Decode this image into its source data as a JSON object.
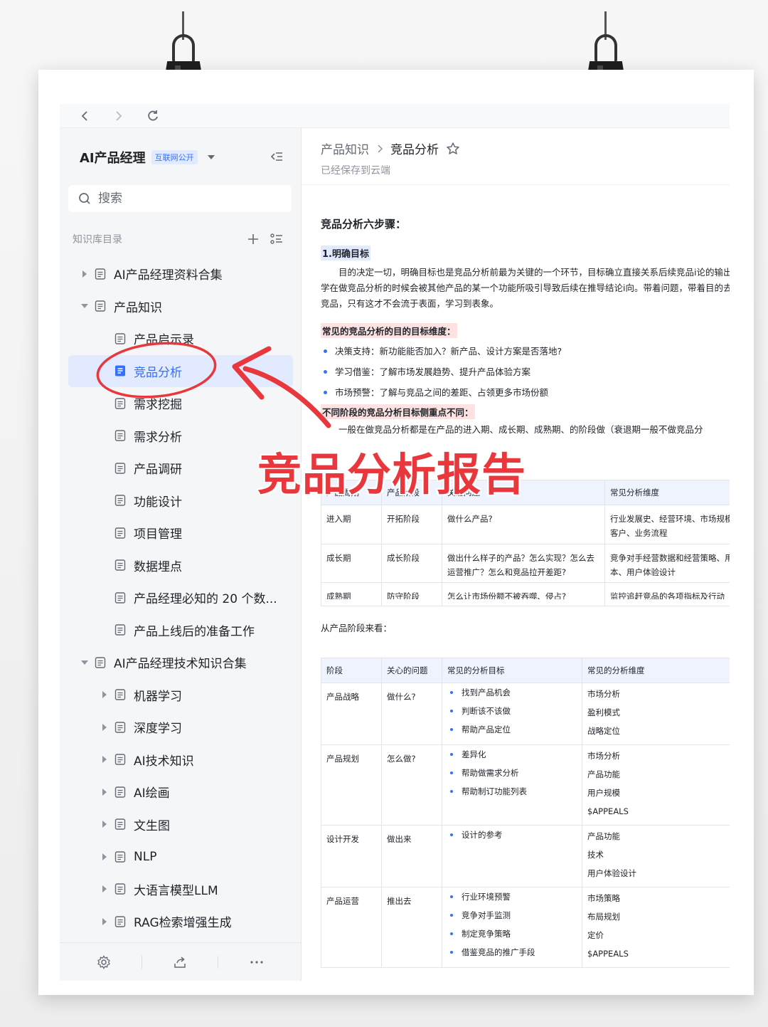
{
  "sidebar": {
    "kb_title": "AI产品经理",
    "kb_badge": "互联网公开",
    "search_placeholder": "搜索",
    "dir_label": "知识库目录",
    "items": [
      {
        "label": "AI产品经理资料合集",
        "level": 0,
        "toggle": "collapsed"
      },
      {
        "label": "产品知识",
        "level": 0,
        "toggle": "expanded"
      },
      {
        "label": "产品启示录",
        "level": 1,
        "toggle": "none"
      },
      {
        "label": "竞品分析",
        "level": 1,
        "toggle": "none",
        "active": true
      },
      {
        "label": "需求挖掘",
        "level": 1,
        "toggle": "none"
      },
      {
        "label": "需求分析",
        "level": 1,
        "toggle": "none"
      },
      {
        "label": "产品调研",
        "level": 1,
        "toggle": "none"
      },
      {
        "label": "功能设计",
        "level": 1,
        "toggle": "none"
      },
      {
        "label": "项目管理",
        "level": 1,
        "toggle": "none"
      },
      {
        "label": "数据埋点",
        "level": 1,
        "toggle": "none"
      },
      {
        "label": "产品经理必知的 20 个数...",
        "level": 1,
        "toggle": "none"
      },
      {
        "label": "产品上线后的准备工作",
        "level": 1,
        "toggle": "none"
      },
      {
        "label": "AI产品经理技术知识合集",
        "level": 0,
        "toggle": "expanded"
      },
      {
        "label": "机器学习",
        "level": 1,
        "toggle": "collapsed"
      },
      {
        "label": "深度学习",
        "level": 1,
        "toggle": "collapsed"
      },
      {
        "label": "AI技术知识",
        "level": 1,
        "toggle": "collapsed"
      },
      {
        "label": "AI绘画",
        "level": 1,
        "toggle": "collapsed"
      },
      {
        "label": "文生图",
        "level": 1,
        "toggle": "collapsed"
      },
      {
        "label": "NLP",
        "level": 1,
        "toggle": "collapsed"
      },
      {
        "label": "大语言模型LLM",
        "level": 1,
        "toggle": "collapsed"
      },
      {
        "label": "RAG检索增强生成",
        "level": 1,
        "toggle": "collapsed"
      }
    ]
  },
  "header": {
    "breadcrumb_parent": "产品知识",
    "breadcrumb_current": "竞品分析",
    "saved_status": "已经保存到云端"
  },
  "doc": {
    "title": "竞品分析六步骤：",
    "step1": "1.明确目标",
    "para1": "目的决定一切，明确目标也是竞品分析前最为关键的一个环节，目标确立直接关系后续竞品i论的输出。很多同学在做竞品分析的时候会被其他产品的某一个功能所吸引导致后续在推导结论i向。带着问题，带着目的去分析体验竞品，只有这才不会流于表面，学习到表象。",
    "hl1": "常见的竞品分析的目的目标维度：",
    "bullets1": [
      "决策支持：新功能能否加入？新产品、设计方案是否落地?",
      "学习借鉴：了解市场发展趋势、提升产品体验方案",
      "市场预警：了解与竞品之间的差距、占领更多市场份额"
    ],
    "hl2": "不同阶段的竞品分析目标侧重点不同：",
    "para2": "一般在做竞品分析都是在产品的进入期、成长期、成熟期、的阶段做（衰退期一般不做竞品分",
    "table1": {
      "headers": [
        "产品周期",
        "产品阶段",
        "关注问题",
        "常见分析维度"
      ],
      "rows": [
        [
          "进入期",
          "开拓阶段",
          "做什么产品?",
          "行业发展史、经营环境、市场规模、产品发展史、目标客户、业务流程"
        ],
        [
          "成长期",
          "成长阶段",
          "做出什么样子的产品？怎么实现？怎么去运营推广？怎么和竞品拉开差距?",
          "竞争对手经营数据和经营策略、用户规模、研发技术成本、用户体验设计"
        ],
        [
          "成熟期",
          "防守阶段",
          "怎么让市场份额不被吞噬、侵占?",
          "监控追赶竞品的各项指标及行动"
        ]
      ]
    },
    "from_stage": "从产品阶段来看：",
    "table2": {
      "headers": [
        "阶段",
        "关心的问题",
        "常见的分析目标",
        "常见的分析维度"
      ],
      "rows": [
        {
          "stage": "产品战略",
          "question": "做什么?",
          "goals": [
            "找到产品机会",
            "判断该不该做",
            "帮助产品定位"
          ],
          "dims": [
            "市场分析",
            "盈利模式",
            "战略定位"
          ]
        },
        {
          "stage": "产品规划",
          "question": "怎么做?",
          "goals": [
            "差异化",
            "帮助做需求分析",
            "帮助制订功能列表"
          ],
          "dims": [
            "市场分析",
            "产品功能",
            "用户规模",
            "$APPEALS"
          ]
        },
        {
          "stage": "设计开发",
          "question": "做出来",
          "goals": [
            "设计的参考"
          ],
          "dims": [
            "产品功能",
            "技术",
            "用户体验设计"
          ]
        },
        {
          "stage": "产品运营",
          "question": "推出去",
          "goals": [
            "行业环境预警",
            "竞争对手监测",
            "制定竞争策略",
            "借鉴竞品的推广手段"
          ],
          "dims": [
            "市场策略",
            "布局规划",
            "定价",
            "$APPEALS"
          ]
        }
      ]
    }
  },
  "overlay": {
    "caption": "竞品分析报告",
    "accent": "#e8383d"
  },
  "colors": {
    "primary": "#3370ff",
    "active_bg": "#e1eaff",
    "highlight_red": "#fde2e2"
  }
}
